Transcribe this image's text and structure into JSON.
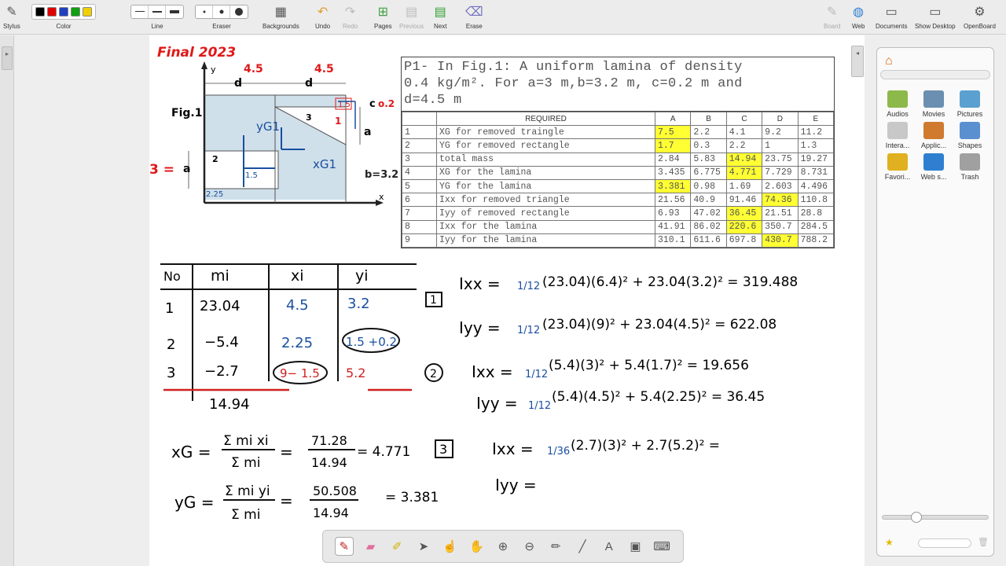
{
  "toolbar": {
    "stylus": "Stylus",
    "color": "Color",
    "line": "Line",
    "eraser": "Eraser",
    "backgrounds": "Backgrounds",
    "undo": "Undo",
    "redo": "Redo",
    "pages": "Pages",
    "previous": "Previous",
    "next": "Next",
    "erase": "Erase",
    "board": "Board",
    "web": "Web",
    "documents": "Documents",
    "show_desktop": "Show Desktop",
    "openboard": "OpenBoard",
    "colors": [
      "#000000",
      "#e00000",
      "#2040c0",
      "#10a010",
      "#f0d000"
    ]
  },
  "library": {
    "items": [
      {
        "label": "Audios",
        "icon": "audio-folder-icon",
        "color": "#8db84a"
      },
      {
        "label": "Movies",
        "icon": "movie-folder-icon",
        "color": "#6a8fb0"
      },
      {
        "label": "Pictures",
        "icon": "pictures-folder-icon",
        "color": "#5aa0d0"
      },
      {
        "label": "Intera...",
        "icon": "interactive-folder-icon",
        "color": "#c8c8c8"
      },
      {
        "label": "Applic...",
        "icon": "applications-folder-icon",
        "color": "#d07a30"
      },
      {
        "label": "Shapes",
        "icon": "shapes-folder-icon",
        "color": "#5a8fd0"
      },
      {
        "label": "Favori...",
        "icon": "favorites-folder-icon",
        "color": "#e0b020"
      },
      {
        "label": "Web s...",
        "icon": "web-search-folder-icon",
        "color": "#2f7fd0"
      },
      {
        "label": "Trash",
        "icon": "trash-icon",
        "color": "#a0a0a0"
      }
    ]
  },
  "problem": {
    "statement": [
      "P1- In Fig.1: A uniform lamina of density",
      "0.4 kg/m². For a=3 m,b=3.2 m, c=0.2 m and",
      "d=4.5 m"
    ],
    "headers": [
      "",
      "REQUIRED",
      "A",
      "B",
      "C",
      "D",
      "E"
    ],
    "rows": [
      [
        "1",
        "XG for removed traingle",
        "7.5",
        "2.2",
        "4.1",
        "9.2",
        "11.2"
      ],
      [
        "2",
        "YG for removed rectangle",
        "1.7",
        "0.3",
        "2.2",
        "1",
        "1.3"
      ],
      [
        "3",
        "total mass",
        "2.84",
        "5.83",
        "14.94",
        "23.75",
        "19.27"
      ],
      [
        "4",
        "XG for the lamina",
        "3.435",
        "6.775",
        "4.771",
        "7.729",
        "8.731"
      ],
      [
        "5",
        "YG for the lamina",
        "3.381",
        "0.98",
        "1.69",
        "2.603",
        "4.496"
      ],
      [
        "6",
        "Ixx for removed triangle",
        "21.56",
        "40.9",
        "91.46",
        "74.36",
        "110.8"
      ],
      [
        "7",
        "Iyy of removed rectangle",
        "6.93",
        "47.02",
        "36.45",
        "21.51",
        "28.8"
      ],
      [
        "8",
        "Ixx for the lamina",
        "41.91",
        "86.02",
        "220.6",
        "350.7",
        "284.5"
      ],
      [
        "9",
        "Iyy for the lamina",
        "310.1",
        "611.6",
        "697.8",
        "430.7",
        "788.2"
      ]
    ],
    "highlighted": [
      "0-2",
      "1-2",
      "2-4",
      "3-4",
      "4-2",
      "5-5",
      "6-4",
      "7-4",
      "8-5"
    ]
  },
  "figure": {
    "fig_label": "Fig.1",
    "y_axis": "y",
    "x_axis": "x",
    "d": "d",
    "a": "a",
    "b": "b=3.2",
    "c": "c",
    "region2": "2",
    "region3": "3",
    "title_red": "Final 2023",
    "dim_red_1": "4.5",
    "dim_red_2": "4.5",
    "a_red": "3 =",
    "c_red": "o.2",
    "note_15a": "1.5",
    "note_15b": "1.5",
    "note_1": "1",
    "note_225": "2.25",
    "note_15c": "1.5",
    "yg1": "yG1",
    "xg1": "xG1"
  },
  "handwriting": {
    "table": {
      "headers": [
        "No",
        "mi",
        "xi",
        "yi"
      ],
      "rows": [
        [
          "1",
          "23.04",
          "4.5",
          "3.2"
        ],
        [
          "2",
          "−5.4",
          "2.25",
          "1.5 +0.2"
        ],
        [
          "3",
          "−2.7",
          "9− 1.5",
          "5.2"
        ]
      ],
      "total": "14.94"
    },
    "xg_lhs": "xG =",
    "xg_num": "Σ mi xi",
    "xg_den": "Σ mi",
    "xg_eq": "=",
    "xg_val_num": "71.28",
    "xg_val_den": "14.94",
    "xg_result": "= 4.771",
    "yg_lhs": "yG =",
    "yg_num": "Σ mi yi",
    "yg_den": "Σ mi",
    "yg_eq": "=",
    "yg_val_num": "50.508",
    "yg_val_den": "14.94",
    "yg_result": "= 3.381",
    "tag1": "1",
    "tag2": "2",
    "tag3": "3",
    "eq1a": "Ixx = ",
    "eq1a_frac": "1/12",
    "eq1a_rest": "(23.04)(6.4)² + 23.04(3.2)² = 319.488",
    "eq1b": "Iyy = ",
    "eq1b_frac": "1/12",
    "eq1b_rest": "(23.04)(9)² + 23.04(4.5)² = 622.08",
    "eq2a": "Ixx = ",
    "eq2a_frac": "1/12",
    "eq2a_rest": "(5.4)(3)² + 5.4(1.7)² = 19.656",
    "eq2b": "Iyy = ",
    "eq2b_frac": "1/12",
    "eq2b_rest": "(5.4)(4.5)² + 5.4(2.25)² = 36.45",
    "eq3a": "Ixx = ",
    "eq3a_frac": "1/36",
    "eq3a_rest": "(2.7)(3)² + 2.7(5.2)² =",
    "eq3b": "Iyy ="
  }
}
